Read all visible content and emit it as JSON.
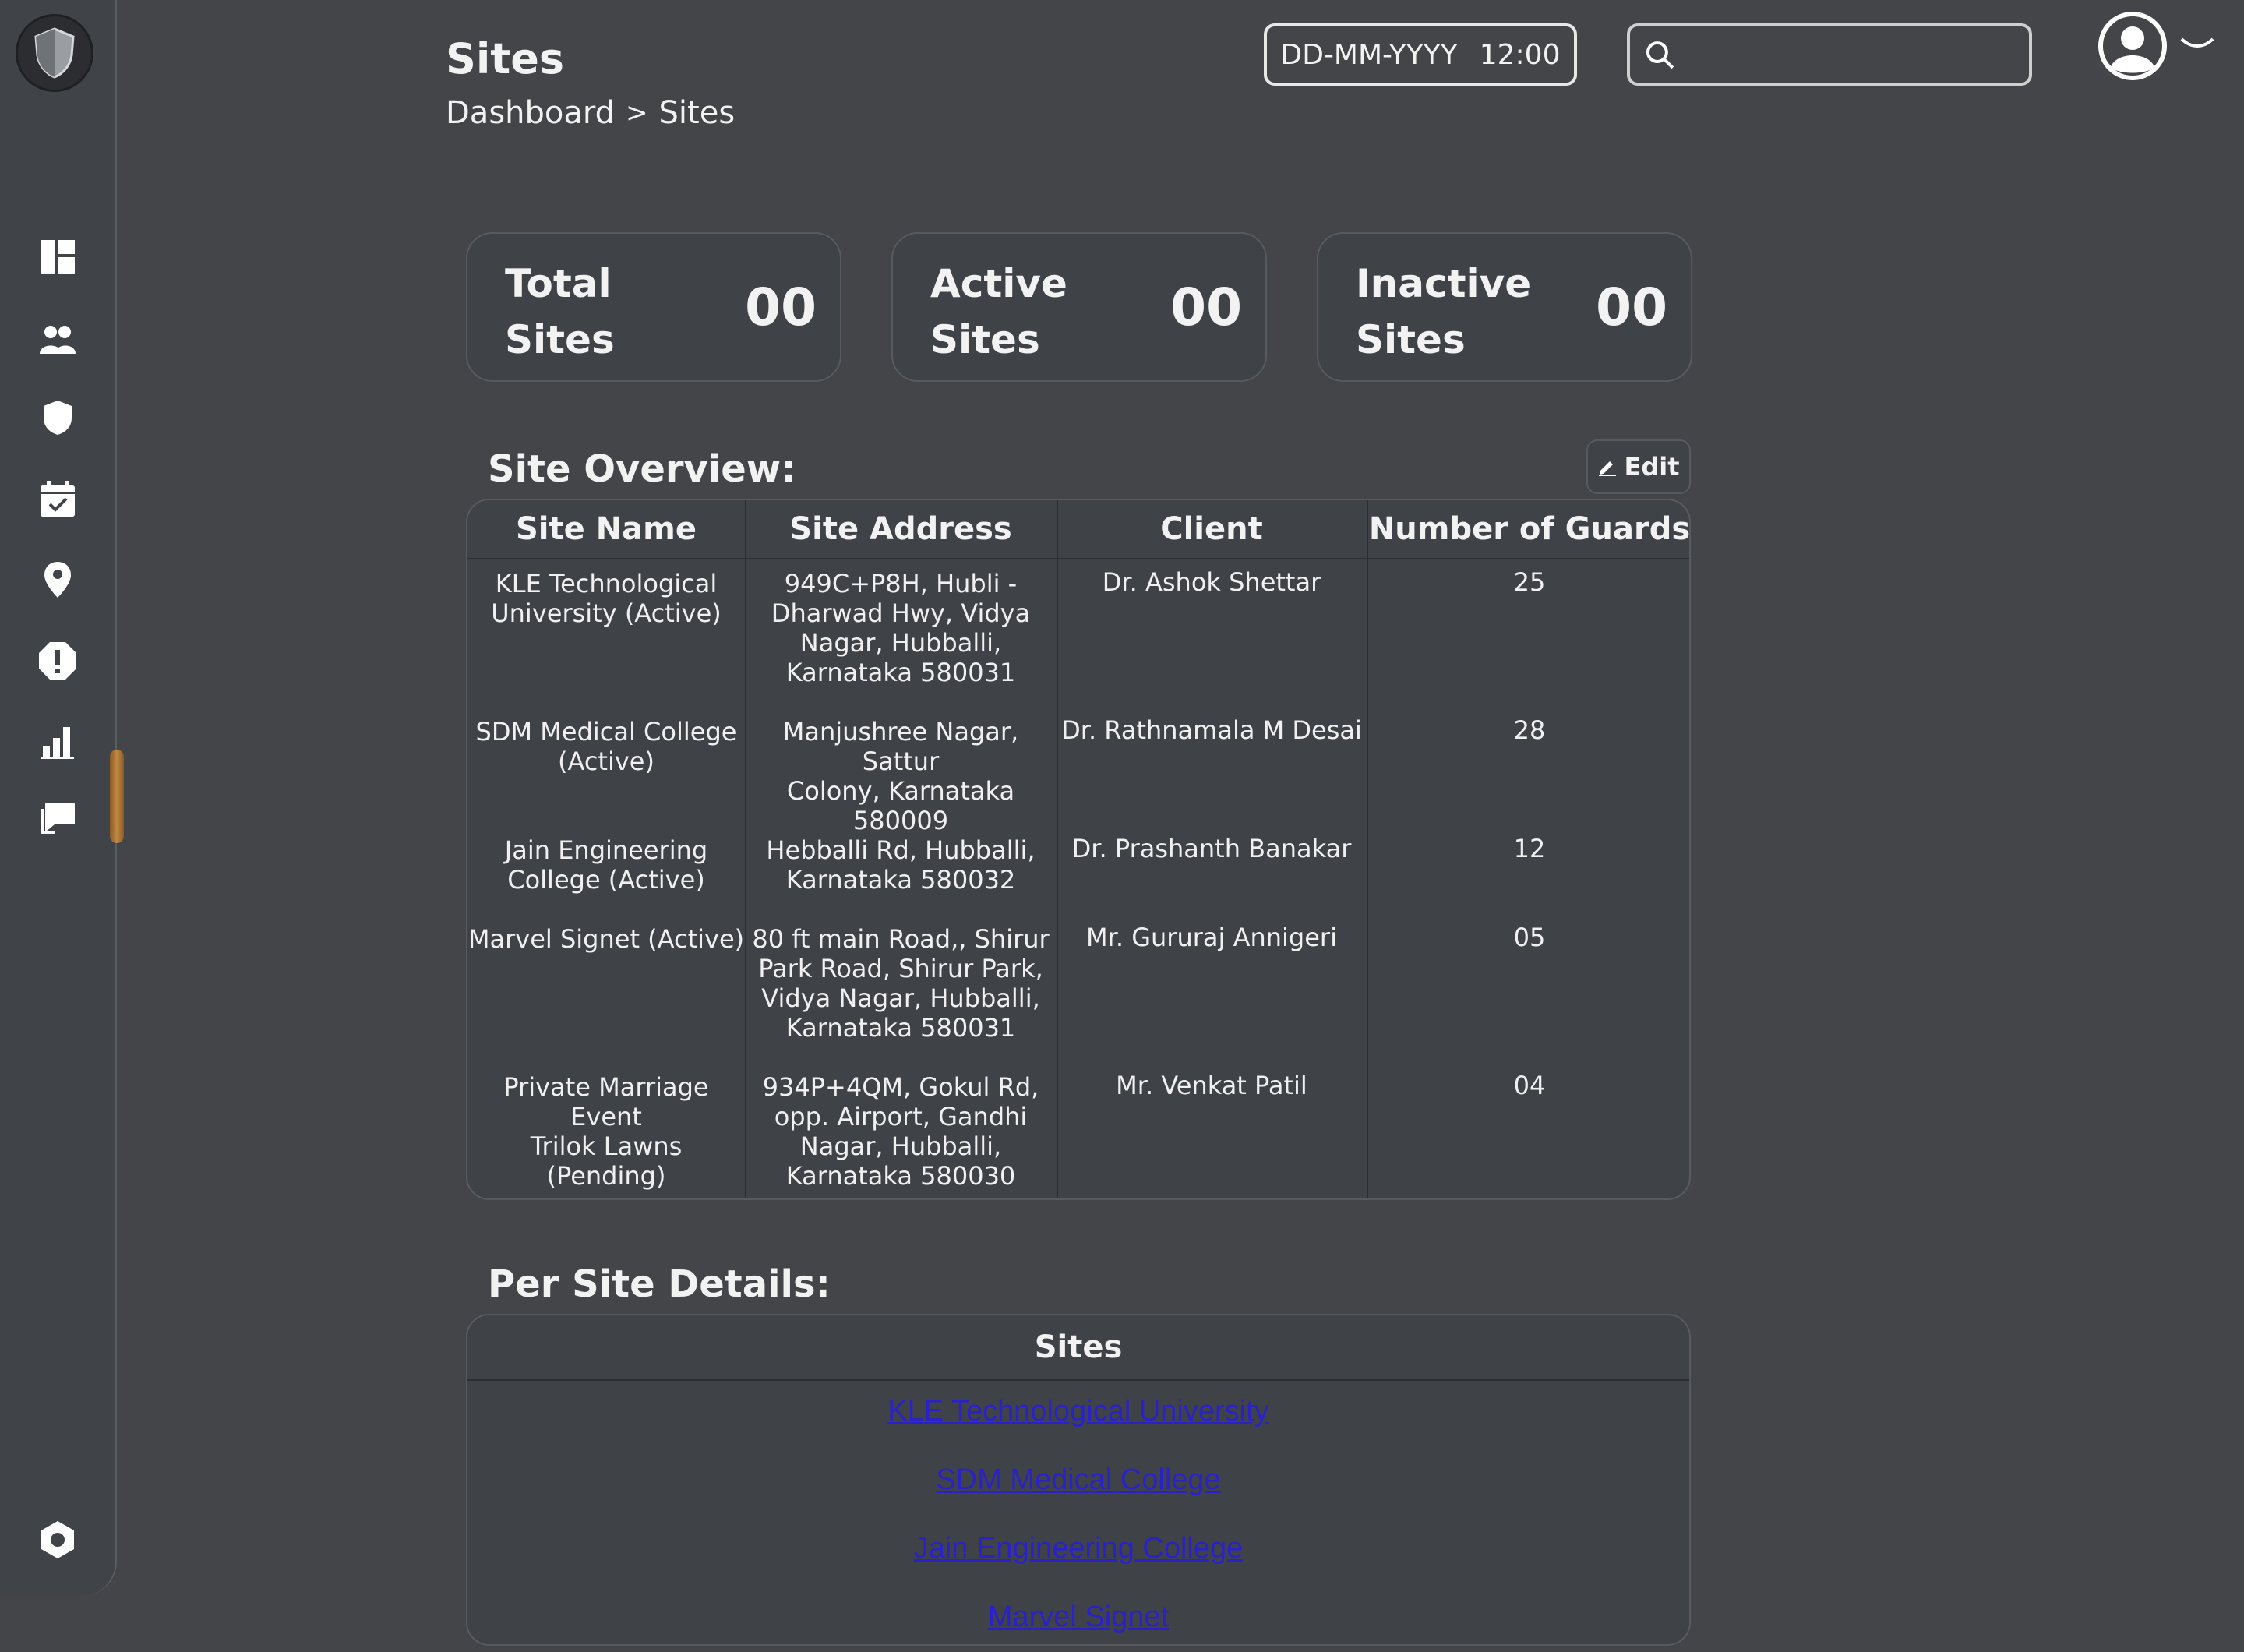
{
  "header": {
    "title": "Sites",
    "breadcrumb": {
      "root": "Dashboard",
      "separator": ">",
      "current": "Sites"
    },
    "date_placeholder": "DD-MM-YYYY",
    "time": "12:00",
    "search_placeholder": ""
  },
  "sidebar": {
    "items": [
      {
        "icon": "dashboard-icon"
      },
      {
        "icon": "users-icon"
      },
      {
        "icon": "shield-icon"
      },
      {
        "icon": "calendar-check-icon"
      },
      {
        "icon": "location-pin-icon"
      },
      {
        "icon": "alert-icon"
      },
      {
        "icon": "bar-chart-icon"
      },
      {
        "icon": "chat-icon"
      }
    ],
    "settings_icon": "settings-icon"
  },
  "stats": [
    {
      "label_line1": "Total",
      "label_line2": "Sites",
      "value": "00"
    },
    {
      "label_line1": "Active",
      "label_line2": "Sites",
      "value": "00"
    },
    {
      "label_line1": "Inactive",
      "label_line2": "Sites",
      "value": "00"
    }
  ],
  "overview": {
    "title": "Site Overview:",
    "edit_label": "Edit",
    "columns": [
      "Site Name",
      "Site Address",
      "Client",
      "Number of Guards"
    ],
    "rows": [
      {
        "name": [
          "KLE Technological",
          "University (Active)"
        ],
        "address": [
          "949C+P8H, Hubli -",
          "Dharwad Hwy, Vidya",
          "Nagar, Hubballi,",
          "Karnataka 580031"
        ],
        "client": "Dr. Ashok Shettar",
        "guards": "25"
      },
      {
        "name": [
          "SDM Medical College",
          "(Active)"
        ],
        "address": [
          "Manjushree Nagar, Sattur",
          "Colony, Karnataka",
          "580009"
        ],
        "client": "Dr. Rathnamala M Desai",
        "guards": "28"
      },
      {
        "name": [
          "Jain Engineering",
          "College (Active)"
        ],
        "address": [
          "Hebballi Rd, Hubballi,",
          "Karnataka 580032"
        ],
        "client": "Dr. Prashanth Banakar",
        "guards": "12"
      },
      {
        "name": [
          "Marvel Signet (Active)"
        ],
        "address": [
          "80 ft main Road,, Shirur",
          "Park Road, Shirur Park,",
          "Vidya Nagar, Hubballi,",
          "Karnataka 580031"
        ],
        "client": "Mr. Gururaj Annigeri",
        "guards": "05"
      },
      {
        "name": [
          "Private Marriage Event",
          "Trilok Lawns (Pending)"
        ],
        "address": [
          "934P+4QM, Gokul Rd,",
          "opp. Airport, Gandhi",
          "Nagar, Hubballi,",
          "Karnataka 580030"
        ],
        "client": "Mr. Venkat Patil",
        "guards": "04"
      }
    ]
  },
  "per_site": {
    "title": "Per Site Details:",
    "column": "Sites",
    "links": [
      "KLE Technological University",
      "SDM Medical College",
      "Jain Engineering College",
      "Marvel Signet"
    ]
  },
  "colors": {
    "background": "#434549",
    "panel": "#3f4348",
    "link": "#2a22c8",
    "scroll_accent": "#c08a44"
  }
}
